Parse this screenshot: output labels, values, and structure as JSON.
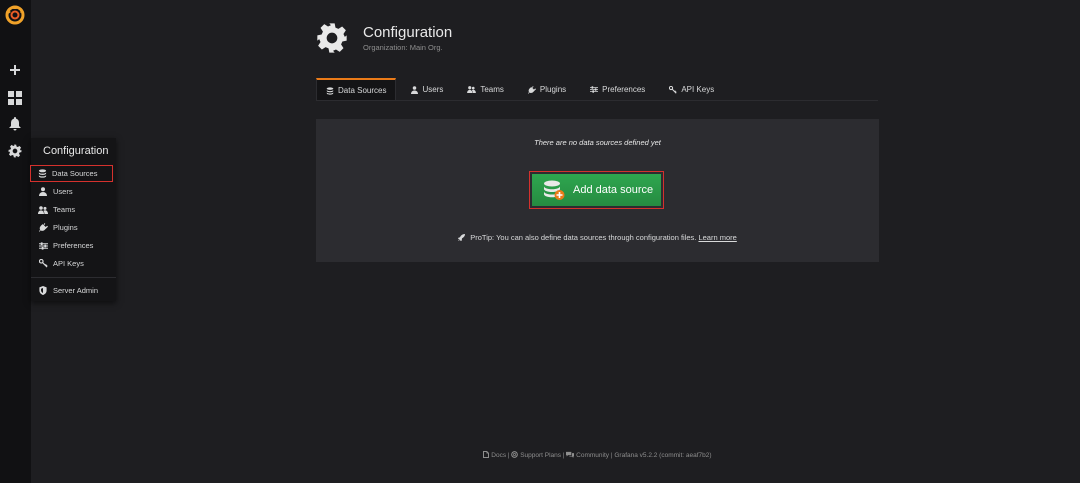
{
  "sidemenu": {
    "icons": [
      "grafana-logo-icon",
      "plus-icon",
      "dashboards-icon",
      "alerting-bell-icon",
      "configuration-gear-icon"
    ]
  },
  "config_menu": {
    "title": "Configuration",
    "items": [
      {
        "label": "Data Sources",
        "icon": "database-icon",
        "active": true
      },
      {
        "label": "Users",
        "icon": "user-icon"
      },
      {
        "label": "Teams",
        "icon": "users-icon"
      },
      {
        "label": "Plugins",
        "icon": "plug-icon"
      },
      {
        "label": "Preferences",
        "icon": "sliders-icon"
      },
      {
        "label": "API Keys",
        "icon": "key-icon"
      }
    ],
    "server_admin": {
      "label": "Server Admin",
      "icon": "shield-icon"
    }
  },
  "header": {
    "title": "Configuration",
    "subtitle": "Organization: Main Org."
  },
  "tabs": [
    {
      "label": "Data Sources",
      "icon": "database-icon",
      "active": true
    },
    {
      "label": "Users",
      "icon": "user-icon"
    },
    {
      "label": "Teams",
      "icon": "users-icon"
    },
    {
      "label": "Plugins",
      "icon": "plug-icon"
    },
    {
      "label": "Preferences",
      "icon": "sliders-icon"
    },
    {
      "label": "API Keys",
      "icon": "key-icon"
    }
  ],
  "empty_state": {
    "title": "There are no data sources defined yet",
    "button_label": "Add data source",
    "protip_text": "ProTip: You can also define data sources through configuration files.",
    "protip_link": "Learn more"
  },
  "footer": {
    "docs": "Docs",
    "support": "Support Plans",
    "community": "Community",
    "version": "Grafana v5.2.2 (commit: aeaf7b2)"
  },
  "colors": {
    "accent_orange": "#eb7b18",
    "success_green": "#299c46",
    "highlight_red": "#d5312d"
  }
}
